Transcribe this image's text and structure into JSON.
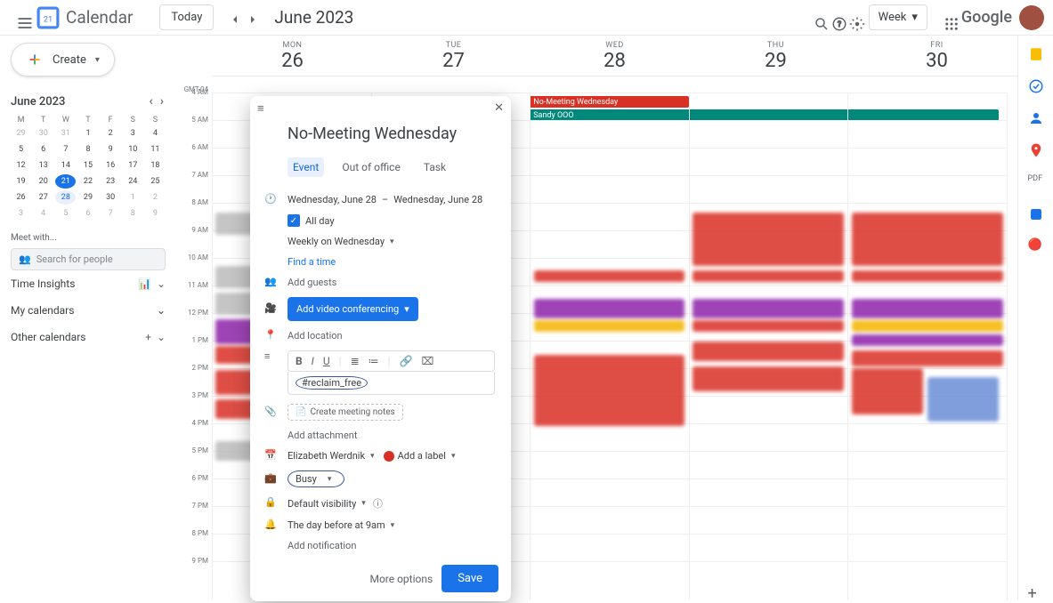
{
  "header": {
    "app_title": "Calendar",
    "today_label": "Today",
    "current_date": "June 2023",
    "view": "Week",
    "google": "Google"
  },
  "sidebar": {
    "create_label": "Create",
    "mini_month": "June 2023",
    "mini_days": [
      "M",
      "T",
      "W",
      "T",
      "F",
      "S",
      "S"
    ],
    "mini_grid": [
      [
        "29",
        "30",
        "31",
        "1",
        "2",
        "3",
        "4"
      ],
      [
        "5",
        "6",
        "7",
        "8",
        "9",
        "10",
        "11"
      ],
      [
        "12",
        "13",
        "14",
        "15",
        "16",
        "17",
        "18"
      ],
      [
        "19",
        "20",
        "21",
        "22",
        "23",
        "24",
        "25"
      ],
      [
        "26",
        "27",
        "28",
        "29",
        "30",
        "1",
        "2"
      ],
      [
        "3",
        "4",
        "5",
        "6",
        "7",
        "8",
        "9"
      ]
    ],
    "today": "21",
    "selected": "28",
    "meet_with": "Meet with...",
    "search_placeholder": "Search for people",
    "time_insights": "Time Insights",
    "my_calendars": "My calendars",
    "other_calendars": "Other calendars"
  },
  "calendar": {
    "timezone": "GMT-04",
    "days": [
      {
        "name": "MON",
        "num": "26"
      },
      {
        "name": "TUE",
        "num": "27"
      },
      {
        "name": "WED",
        "num": "28"
      },
      {
        "name": "THU",
        "num": "29"
      },
      {
        "name": "FRI",
        "num": "30"
      }
    ],
    "hours": [
      "4 AM",
      "5 AM",
      "6 AM",
      "7 AM",
      "8 AM",
      "9 AM",
      "10 AM",
      "11 AM",
      "12 PM",
      "1 PM",
      "2 PM",
      "3 PM",
      "4 PM",
      "5 PM",
      "6 PM",
      "7 PM",
      "8 PM",
      "9 PM"
    ],
    "allday": {
      "no_meeting": "No-Meeting Wednesday",
      "sandy_ooo": "Sandy OOO"
    }
  },
  "dialog": {
    "title": "No-Meeting Wednesday",
    "tabs": [
      "Event",
      "Out of office",
      "Task"
    ],
    "date_from": "Wednesday, June 28",
    "date_to": "Wednesday, June 28",
    "all_day": "All day",
    "recurrence": "Weekly on Wednesday",
    "find_time": "Find a time",
    "add_guests": "Add guests",
    "video_conf": "Add video conferencing",
    "add_location": "Add location",
    "description": "#reclaim_free",
    "meeting_notes": "Create meeting notes",
    "add_attachment": "Add attachment",
    "calendar_owner": "Elizabeth Werdnik",
    "add_label": "Add a label",
    "busy": "Busy",
    "visibility": "Default visibility",
    "notification": "The day before at 9am",
    "add_notification": "Add notification",
    "more_options": "More options",
    "save": "Save"
  }
}
